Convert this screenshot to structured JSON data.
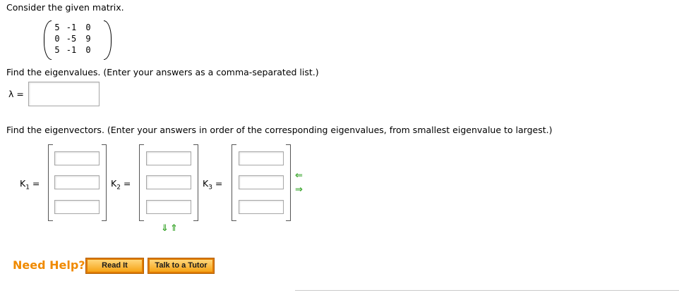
{
  "question": {
    "intro": "Consider the given matrix.",
    "matrix": [
      [
        "5",
        "-1",
        "0"
      ],
      [
        "0",
        "-5",
        "9"
      ],
      [
        "5",
        "-1",
        "0"
      ]
    ],
    "eigenvalues_prompt": "Find the eigenvalues. (Enter your answers as a comma-separated list.)",
    "lambda_label": "λ =",
    "lambda_value": "",
    "eigenvectors_prompt": "Find the eigenvectors. (Enter your answers in order of the corresponding eigenvalues, from smallest eigenvalue to largest.)",
    "k_labels": [
      "K",
      "K",
      "K"
    ],
    "k_subs": [
      "1",
      "2",
      "3"
    ],
    "equals": "="
  },
  "arrows": {
    "left": "⇐",
    "right": "⇒",
    "down": "⇓",
    "up": "⇑"
  },
  "help": {
    "title": "Need Help?",
    "read_it": "Read It",
    "talk_to_tutor": "Talk to a Tutor"
  },
  "colors": {
    "help_orange": "#f08a00",
    "arrow_green": "#3aa52c",
    "button_fill": "#f6a316"
  }
}
